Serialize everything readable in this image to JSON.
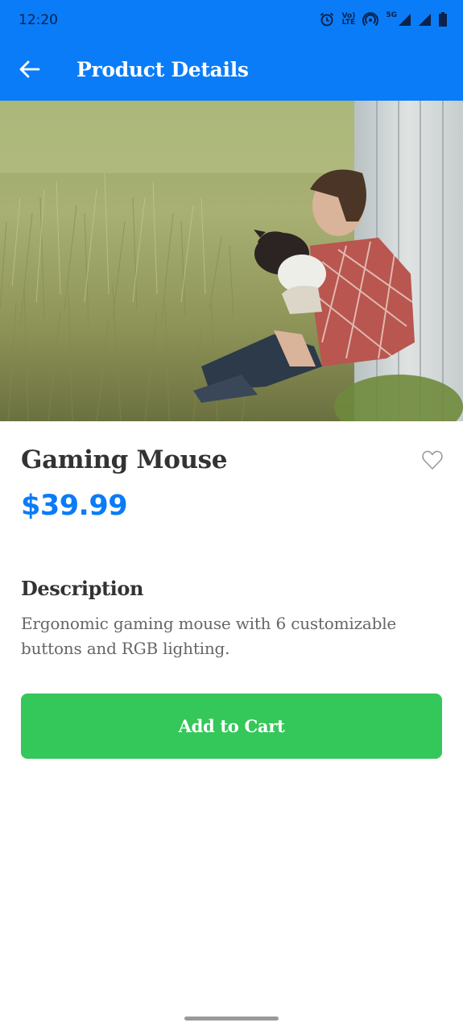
{
  "status_bar": {
    "time": "12:20",
    "icons": [
      "alarm-icon",
      "volte-icon",
      "hotspot-icon",
      "signal-5g-icon",
      "signal-icon",
      "battery-icon"
    ],
    "volte_top": "Vo)",
    "volte_bottom": "LTE",
    "network": "5G"
  },
  "app_bar": {
    "back_icon": "arrow-left-icon",
    "title": "Product Details",
    "background": "#0a7cf8"
  },
  "product": {
    "name": "Gaming Mouse",
    "price": "$39.99",
    "favorite_icon": "heart-outline-icon",
    "description_heading": "Description",
    "description": "Ergonomic gaming mouse with 6 customizable buttons and RGB lighting."
  },
  "actions": {
    "add_to_cart": "Add to Cart",
    "button_color": "#34c759"
  },
  "colors": {
    "primary": "#0a7cf8",
    "price": "#0a7cf8",
    "title_text": "#333333",
    "body_text": "#666666"
  }
}
